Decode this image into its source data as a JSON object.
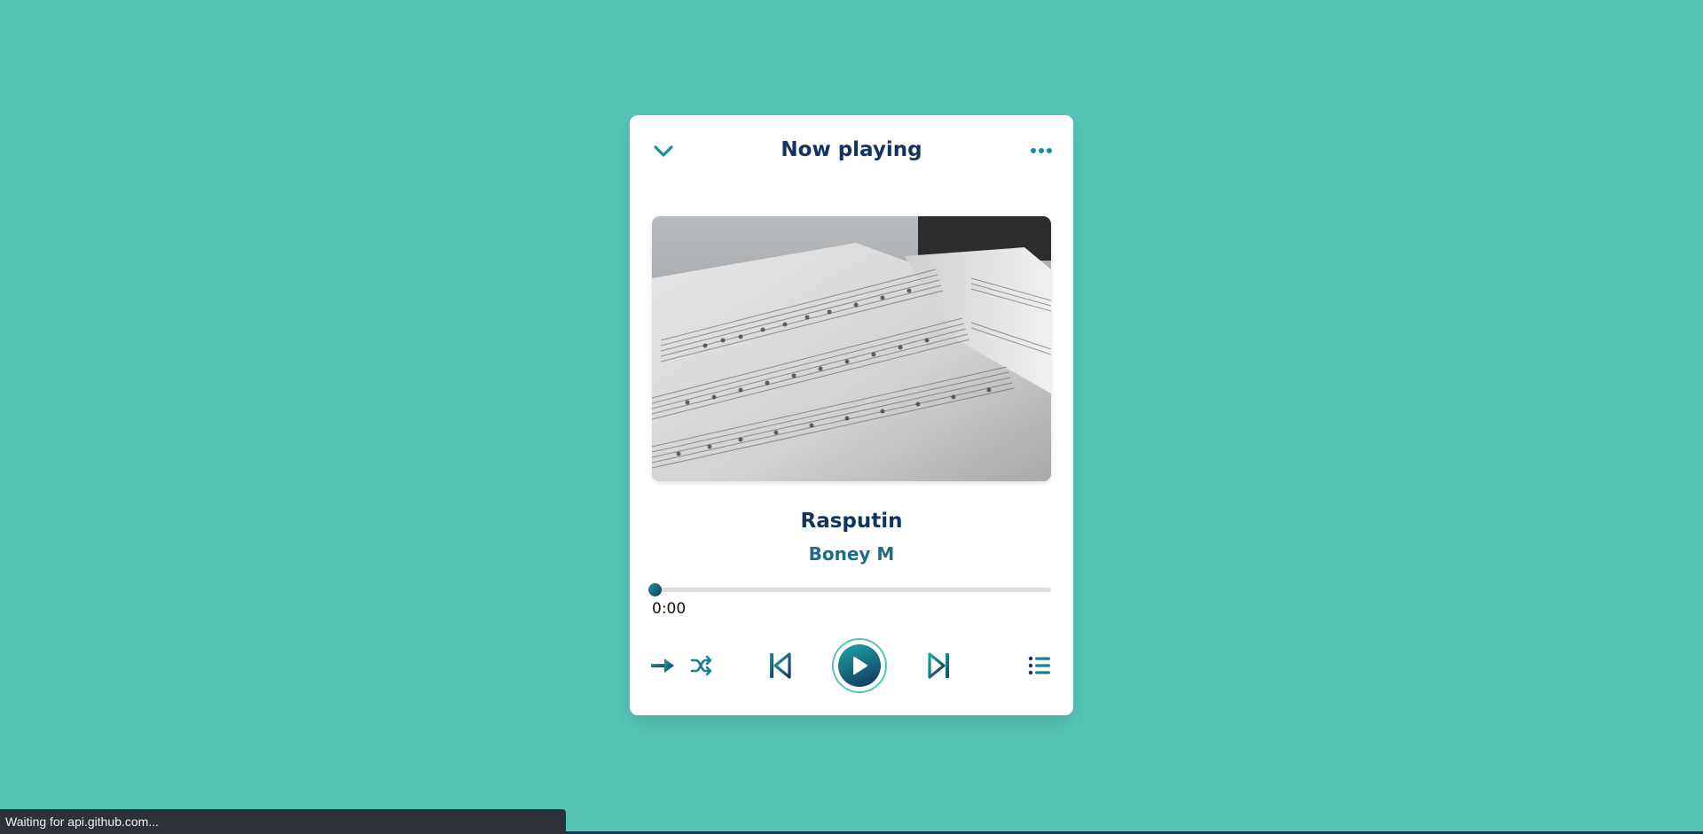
{
  "header": {
    "title": "Now playing",
    "collapse_icon": "chevron-down-icon",
    "more_icon": "more-dots-icon"
  },
  "track": {
    "title": "Rasputin",
    "artist": "Boney M",
    "cover_alt": "sheet music",
    "progress": 0,
    "current_time": "0:00"
  },
  "controls": {
    "repeat_icon": "arrow-right-icon",
    "shuffle_icon": "shuffle-icon",
    "previous_icon": "skip-previous-icon",
    "play_icon": "play-icon",
    "next_icon": "skip-next-icon",
    "playlist_icon": "list-icon"
  },
  "browser_status": {
    "text": "Waiting for api.github.com..."
  },
  "colors": {
    "background": "#57c5b6",
    "card": "#ffffff",
    "title": "#12335c",
    "artist": "#1f6b8c",
    "accent": "#1a7f94",
    "track": "#dedede",
    "status_bar": "#2e3137"
  }
}
